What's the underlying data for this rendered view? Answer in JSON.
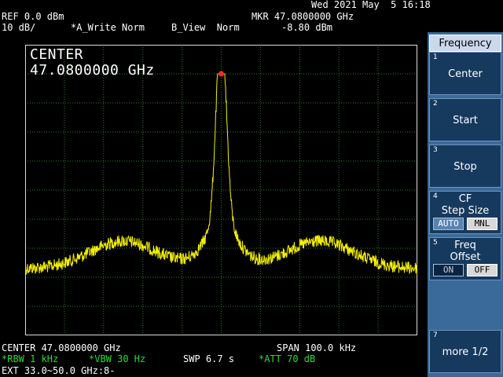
{
  "header": {
    "datetime": "Wed 2021 May  5 16:18",
    "ref_level": "REF 0.0 dBm",
    "scale": "10 dB/",
    "trace_a": "*A_Write Norm",
    "trace_b": "B_View  Norm",
    "marker_label": "MKR 47.0800000 GHz",
    "marker_level": "-8.80 dBm"
  },
  "screen": {
    "center_label": "CENTER",
    "center_value": "47.0800000 GHz",
    "trace_color": "#f5f000",
    "marker_color": "#ff2a2a",
    "grid_color": "#2a7a2a",
    "border_color": "#dcdcdc"
  },
  "footer": {
    "center": "CENTER 47.0800000 GHz",
    "span": "SPAN 100.0 kHz",
    "rbw": "*RBW 1 kHz",
    "vbw": "*VBW 30 Hz",
    "sweep": "SWP 6.7 s",
    "att": "*ATT 70 dB",
    "ext": "EXT 33.0~50.0 GHz:8-"
  },
  "menu": {
    "title": "Frequency",
    "keys": [
      {
        "num": "1",
        "label": "Center"
      },
      {
        "num": "2",
        "label": "Start"
      },
      {
        "num": "3",
        "label": "Stop"
      },
      {
        "num": "4",
        "label": "CF\nStep Size",
        "on": "AUTO",
        "off": "MNL"
      },
      {
        "num": "5",
        "label": "Freq\nOffset",
        "on": "ON",
        "off": "OFF"
      },
      {
        "num": "7",
        "label": "more 1/2"
      }
    ]
  }
}
